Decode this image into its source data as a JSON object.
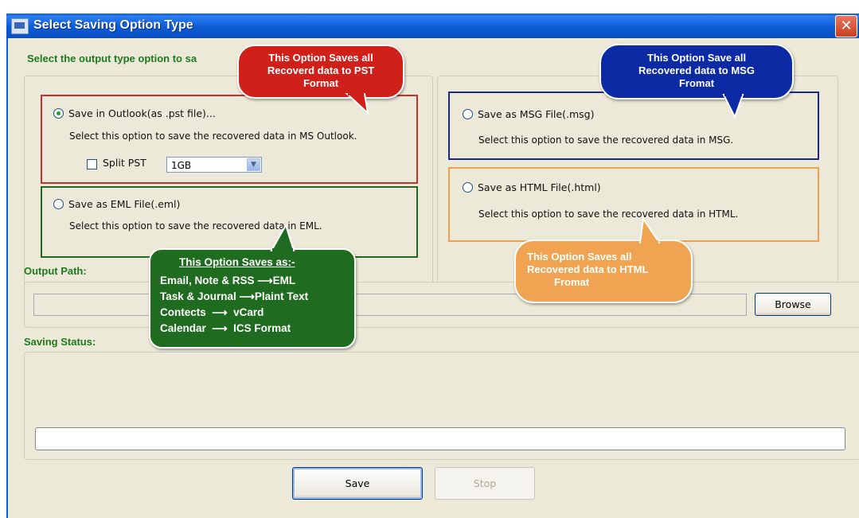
{
  "window": {
    "title": "Select Saving Option Type",
    "close_label": "✕"
  },
  "instruction": "Select the output type option to sa",
  "options": {
    "pst": {
      "label": "Save in Outlook(as .pst file)...",
      "description": "Select this option to save the recovered data in MS Outlook.",
      "checked": true,
      "split_label": "Split PST",
      "split_checked": false,
      "split_size": "1GB"
    },
    "eml": {
      "label": "Save as EML File(.eml)",
      "description": "Select this option to save the recovered data in EML.",
      "checked": false
    },
    "msg": {
      "label": "Save as MSG File(.msg)",
      "description": "Select this option to save the recovered data in MSG.",
      "checked": false
    },
    "html": {
      "label": "Save as HTML File(.html)",
      "description": "Select this option to save the recovered data in HTML.",
      "checked": false
    }
  },
  "output_path": {
    "label": "Output Path:",
    "value": "",
    "browse_label": "Browse"
  },
  "saving_status": {
    "label": "Saving Status:",
    "value": ""
  },
  "buttons": {
    "save": "Save",
    "stop": "Stop"
  },
  "callouts": {
    "pst": [
      "This Option Saves all",
      "Recoverd data to PST",
      "Format"
    ],
    "msg": [
      "This Option Save all",
      "Recovered data to MSG",
      "Fromat"
    ],
    "html": [
      "This Option Saves all",
      "Recovered data to HTML",
      "Fromat"
    ],
    "eml": {
      "heading": "This Option Saves as:-",
      "rows": [
        {
          "left": "Email, Note & RSS",
          "right": "EML"
        },
        {
          "left": "Task & Journal",
          "right": "Plaint Text"
        },
        {
          "left": "Contects",
          "right": "vCard"
        },
        {
          "left": "Calendar",
          "right": "ICS Format"
        }
      ]
    }
  },
  "colors": {
    "title_bar": "#0a5fe3",
    "section_label": "#1e7a1e",
    "pst_border": "#c8302a",
    "eml_border": "#1f6a1f",
    "msg_border": "#1a2a8c",
    "html_border": "#f0a04c",
    "pst_bubble": "#d0201a",
    "msg_bubble": "#0b2aa3",
    "html_bubble": "#f0a451",
    "eml_bubble": "#1f6b1f"
  },
  "icons": {
    "app": "app-icon",
    "close": "close-icon",
    "dropdown": "chevron-down-icon",
    "arrow": "arrow-right-icon"
  }
}
